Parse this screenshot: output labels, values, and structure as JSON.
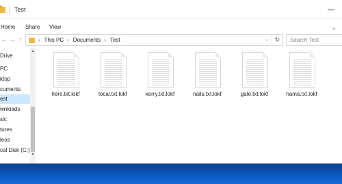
{
  "window": {
    "title": "Test"
  },
  "ribbon": {
    "tabs": [
      "Home",
      "Share",
      "View"
    ]
  },
  "address": {
    "breadcrumbs": [
      "This PC",
      "Documents",
      "Test"
    ],
    "separator": "›",
    "search_placeholder": "Search Test"
  },
  "icons": {
    "back": "←",
    "forward": "→",
    "up": "↑",
    "dropdown": "⌵",
    "refresh": "↻",
    "expand": "⌄",
    "scroll_up": "▲",
    "scroll_down": "▼"
  },
  "sidebar": {
    "items": [
      "Drive",
      "PC",
      "ktop",
      "cuments",
      "est",
      "wnloads",
      "sic",
      "tures",
      "leos",
      "cal Disk (C:)"
    ],
    "selected_index": 4
  },
  "files": [
    {
      "name": "here.txt.lokf"
    },
    {
      "name": "local.txt.lokf"
    },
    {
      "name": "kerry.txt.lokf"
    },
    {
      "name": "nails.txt.lokf"
    },
    {
      "name": "gale.txt.lokf"
    },
    {
      "name": "hama.txt.lokf"
    }
  ],
  "colors": {
    "accent_selected": "#cce8ff",
    "folder": "#e8b84a",
    "desktop": "#1565c0"
  }
}
